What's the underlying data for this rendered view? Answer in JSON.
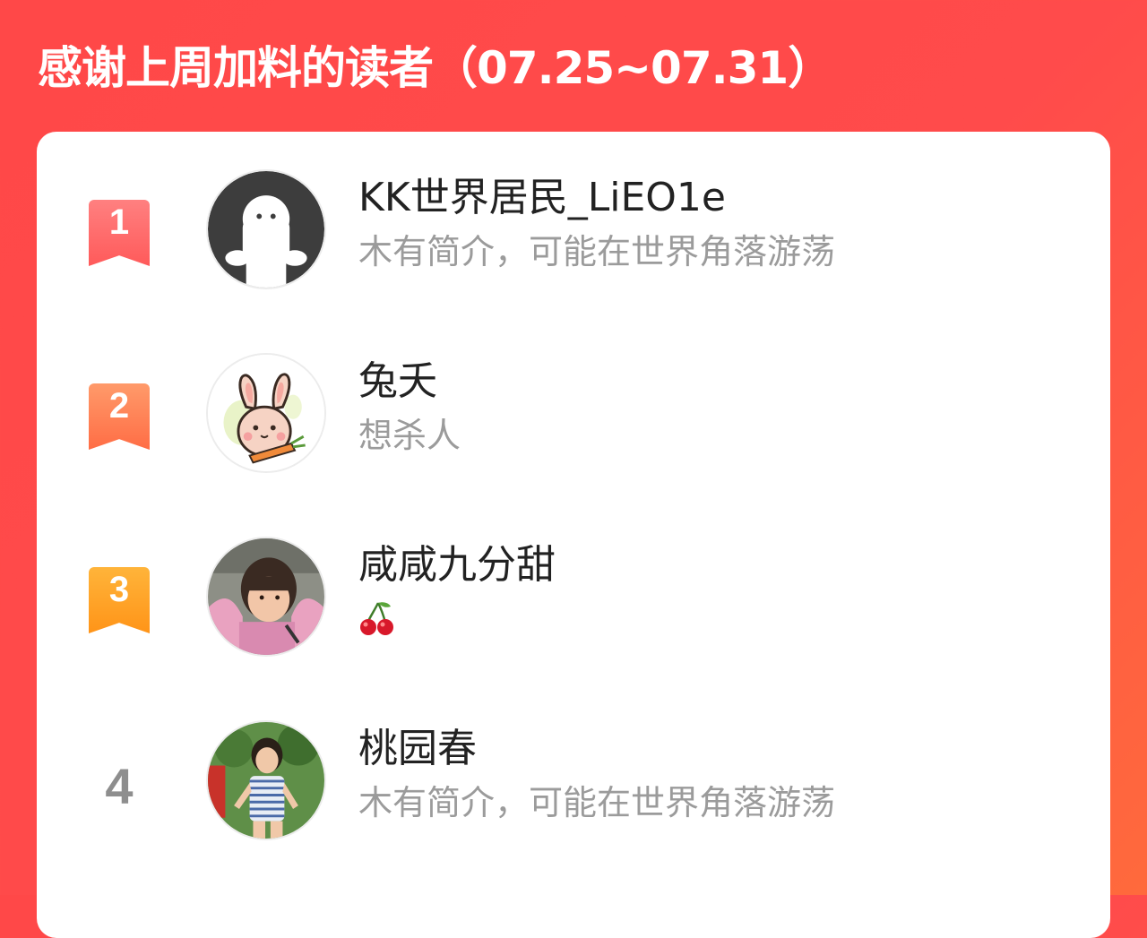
{
  "header": {
    "title": "感谢上周加料的读者（07.25~07.31）"
  },
  "colors": {
    "background": "#ff4848",
    "rank_1": "#ff6b6b",
    "rank_2": "#ff7f56",
    "rank_3": "#ffa52a",
    "rank_plain": "#8e8e8e"
  },
  "readers": [
    {
      "rank": "1",
      "name": "KK世界居民_LiEO1e",
      "bio": "木有简介，可能在世界角落游荡",
      "avatar": "default-ghost-avatar"
    },
    {
      "rank": "2",
      "name": "兔夭",
      "bio": "想杀人",
      "avatar": "bunny-carrot-avatar"
    },
    {
      "rank": "3",
      "name": "咸咸九分甜",
      "bio": "",
      "bio_icon": "cherry-icon",
      "avatar": "child-photo-avatar"
    },
    {
      "rank": "4",
      "name": "桃园春",
      "bio": "木有简介，可能在世界角落游荡",
      "avatar": "girl-photo-avatar"
    }
  ]
}
